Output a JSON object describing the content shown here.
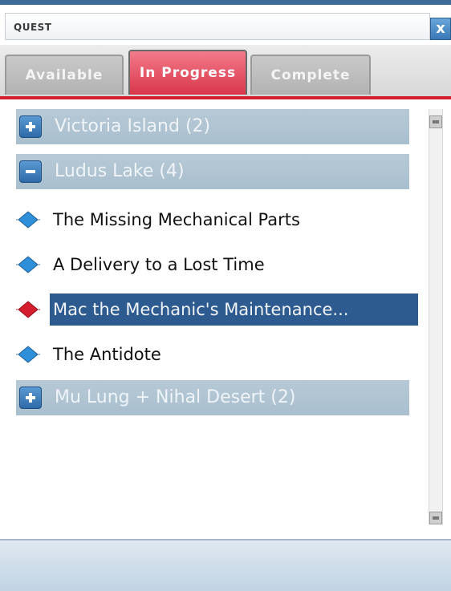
{
  "window": {
    "title": "QUEST",
    "close_label": "x"
  },
  "tabs": [
    {
      "label": "Available"
    },
    {
      "label": "In Progress",
      "active": true
    },
    {
      "label": "Complete"
    }
  ],
  "list": {
    "groups": [
      {
        "label": "Victoria Island (2)",
        "expanded": false
      },
      {
        "label": "Ludus Lake (4)",
        "expanded": true
      },
      {
        "label": "Mu Lung + Nihal Desert (2)",
        "expanded": false
      }
    ],
    "quests": [
      {
        "label": "The Missing Mechanical Parts",
        "icon_color": "#2f8fd8"
      },
      {
        "label": "A Delivery to a Lost Time",
        "icon_color": "#2f8fd8"
      },
      {
        "label": "Mac the Mechanic's Maintenance...",
        "icon_color": "#d41e2e",
        "selected": true
      },
      {
        "label": "The Antidote",
        "icon_color": "#2f8fd8"
      }
    ]
  },
  "colors": {
    "accent": "#d41e2e",
    "selection": "#2e5b8f",
    "group_bg": "#b7c9d6"
  }
}
